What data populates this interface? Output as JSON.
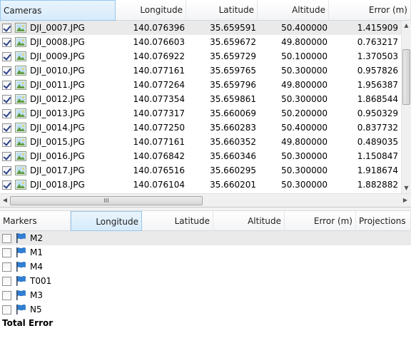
{
  "cameras": {
    "columns": [
      "Cameras",
      "Longitude",
      "Latitude",
      "Altitude",
      "Error (m)"
    ],
    "rows": [
      {
        "name": "DJI_0007.JPG",
        "checked": true,
        "longitude": "140.076396",
        "latitude": "35.659591",
        "altitude": "50.400000",
        "error": "1.415909"
      },
      {
        "name": "DJI_0008.JPG",
        "checked": true,
        "longitude": "140.076603",
        "latitude": "35.659672",
        "altitude": "49.800000",
        "error": "0.763217"
      },
      {
        "name": "DJI_0009.JPG",
        "checked": true,
        "longitude": "140.076922",
        "latitude": "35.659729",
        "altitude": "50.100000",
        "error": "1.370503"
      },
      {
        "name": "DJI_0010.JPG",
        "checked": true,
        "longitude": "140.077161",
        "latitude": "35.659765",
        "altitude": "50.300000",
        "error": "0.957826"
      },
      {
        "name": "DJI_0011.JPG",
        "checked": true,
        "longitude": "140.077264",
        "latitude": "35.659796",
        "altitude": "49.800000",
        "error": "1.956387"
      },
      {
        "name": "DJI_0012.JPG",
        "checked": true,
        "longitude": "140.077354",
        "latitude": "35.659861",
        "altitude": "50.300000",
        "error": "1.868544"
      },
      {
        "name": "DJI_0013.JPG",
        "checked": true,
        "longitude": "140.077317",
        "latitude": "35.660069",
        "altitude": "50.200000",
        "error": "0.950329"
      },
      {
        "name": "DJI_0014.JPG",
        "checked": true,
        "longitude": "140.077250",
        "latitude": "35.660283",
        "altitude": "50.400000",
        "error": "0.837732"
      },
      {
        "name": "DJI_0015.JPG",
        "checked": true,
        "longitude": "140.077161",
        "latitude": "35.660352",
        "altitude": "49.800000",
        "error": "0.489035"
      },
      {
        "name": "DJI_0016.JPG",
        "checked": true,
        "longitude": "140.076842",
        "latitude": "35.660346",
        "altitude": "50.300000",
        "error": "1.150847"
      },
      {
        "name": "DJI_0017.JPG",
        "checked": true,
        "longitude": "140.076516",
        "latitude": "35.660295",
        "altitude": "50.300000",
        "error": "1.918674"
      },
      {
        "name": "DJI_0018.JPG",
        "checked": true,
        "longitude": "140.076104",
        "latitude": "35.660201",
        "altitude": "50.300000",
        "error": "1.882882"
      }
    ],
    "hscroll_grip": "III"
  },
  "markers": {
    "columns": [
      "Markers",
      "Longitude",
      "Latitude",
      "Altitude",
      "Error (m)",
      "Projections"
    ],
    "rows": [
      {
        "name": "M2",
        "checked": false
      },
      {
        "name": "M1",
        "checked": false
      },
      {
        "name": "M4",
        "checked": false
      },
      {
        "name": "T001",
        "checked": false
      },
      {
        "name": "M3",
        "checked": false
      },
      {
        "name": "N5",
        "checked": false
      }
    ],
    "total_label": "Total Error"
  },
  "icons": {
    "camera_row_icon": "photo-thumbnail-icon",
    "marker_row_icon": "blue-flag-icon",
    "sort_indicator": "sort-ascending-icon"
  },
  "colors": {
    "sorted_header_border": "#98c6ea",
    "sorted_header_fill": "#d7ebfb",
    "first_row_highlight": "#eaeaea",
    "flag_blue": "#2f7fd6"
  }
}
